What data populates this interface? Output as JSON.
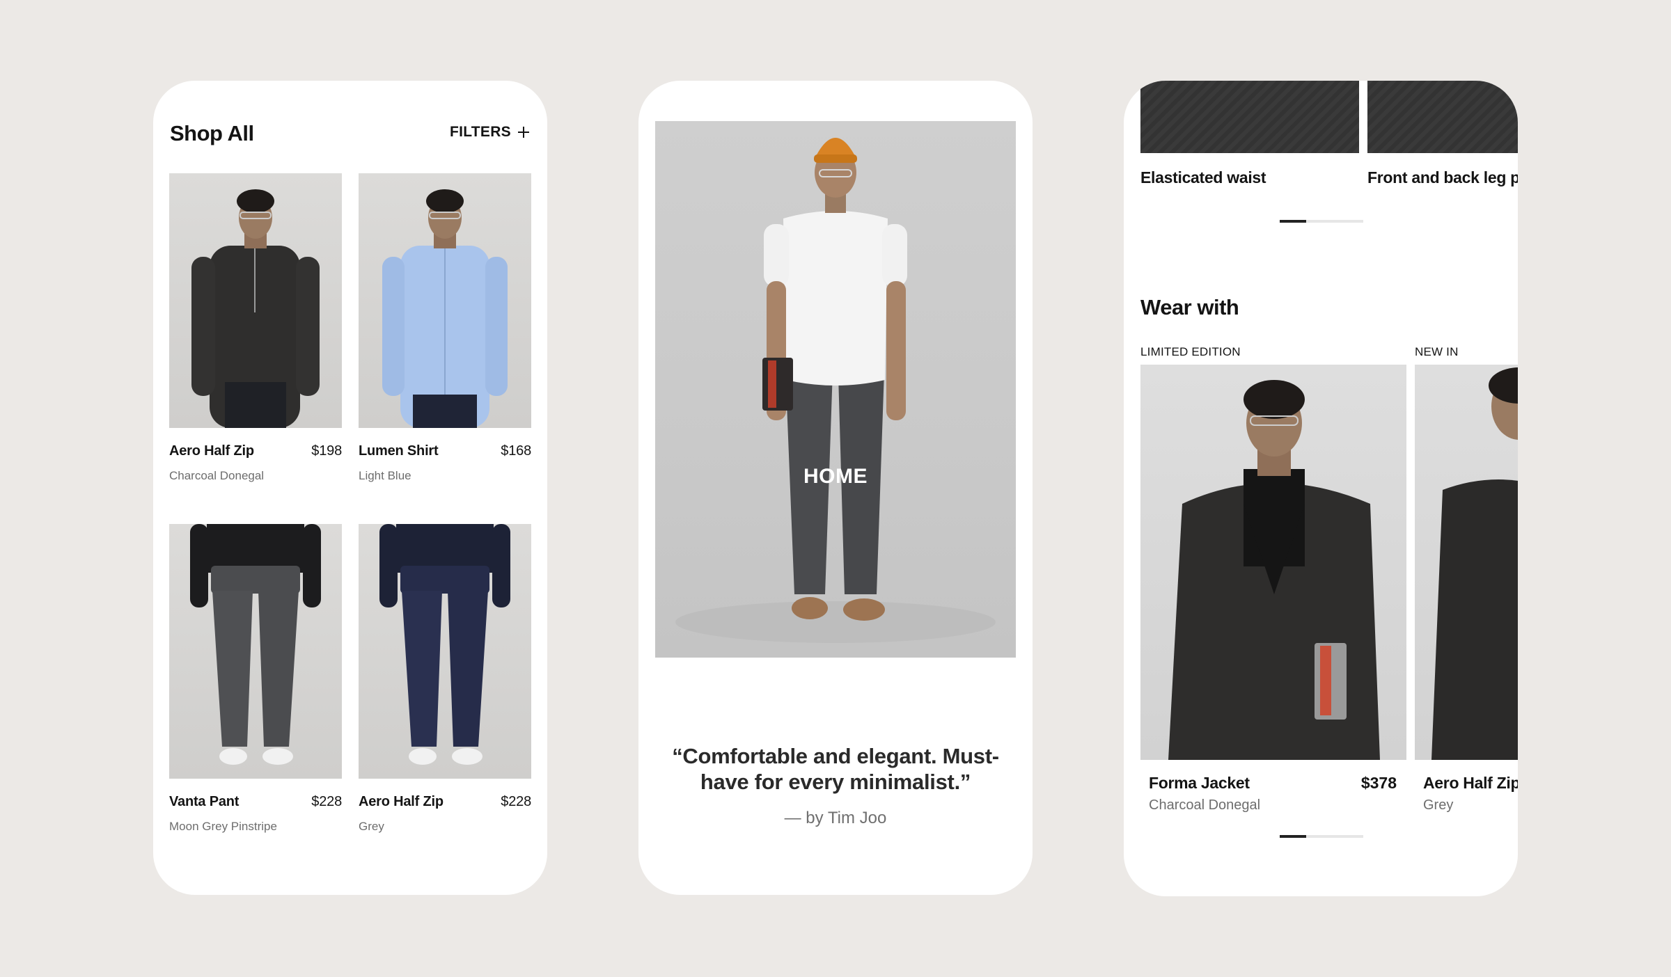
{
  "shop": {
    "title": "Shop All",
    "filters_label": "FILTERS",
    "products": [
      {
        "name": "Aero Half Zip",
        "price": "$198",
        "color": "Charcoal Donegal"
      },
      {
        "name": "Lumen Shirt",
        "price": "$168",
        "color": "Light Blue"
      },
      {
        "name": "Vanta Pant",
        "price": "$228",
        "color": "Moon Grey Pinstripe"
      },
      {
        "name": "Aero Half Zip",
        "price": "$228",
        "color": "Grey"
      }
    ]
  },
  "home": {
    "hero_label": "HOME",
    "quote": "“Comfortable and elegant. Must-have for every minimalist.”",
    "byline": "— by Tim Joo"
  },
  "detail": {
    "features": [
      "Elasticated waist",
      "Front and back leg pi"
    ],
    "wear_with_title": "Wear with",
    "recommendations": [
      {
        "badge": "LIMITED EDITION",
        "name": "Forma Jacket",
        "price": "$378",
        "color": "Charcoal Donegal"
      },
      {
        "badge": "NEW IN",
        "name": "Aero Half Zip",
        "color": "Grey"
      }
    ]
  },
  "icons": {
    "filters": "plus-icon"
  },
  "colors": {
    "background": "#ece9e6",
    "card": "#ffffff",
    "text": "#141414",
    "muted": "#6d6d6d",
    "beanie": "#d98324"
  }
}
